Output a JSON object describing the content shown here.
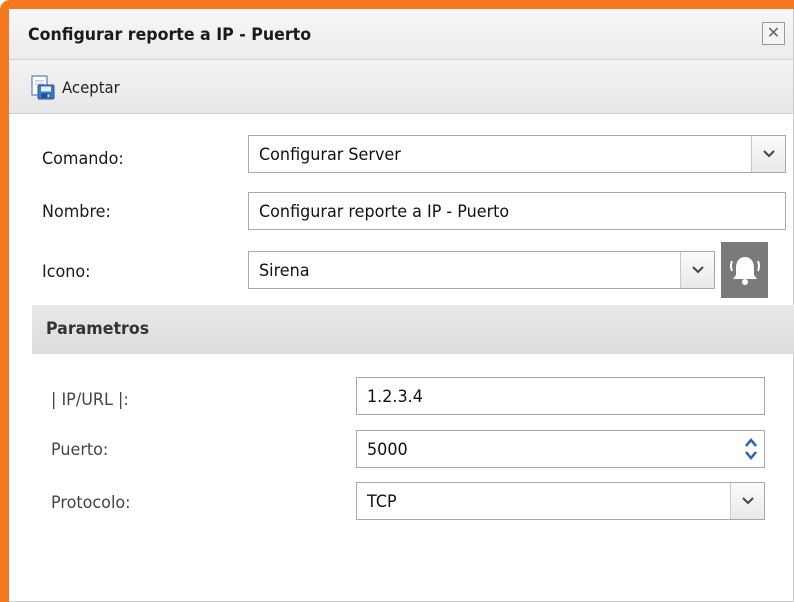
{
  "window": {
    "title": "Configurar reporte a IP - Puerto",
    "close_glyph": "✕"
  },
  "toolbar": {
    "accept_label": "Aceptar",
    "accept_icon": "save-document-icon"
  },
  "form": {
    "comando": {
      "label": "Comando:",
      "value": "Configurar Server"
    },
    "nombre": {
      "label": "Nombre:",
      "value": "Configurar reporte a IP - Puerto"
    },
    "icono": {
      "label": "Icono:",
      "value": "Sirena",
      "preview_icon": "bell-icon"
    }
  },
  "parametros": {
    "title": "Parametros",
    "ip": {
      "label": "| IP/URL |:",
      "value": "1.2.3.4"
    },
    "puerto": {
      "label": "Puerto:",
      "value": "5000"
    },
    "protocolo": {
      "label": "Protocolo:",
      "value": "TCP"
    }
  },
  "colors": {
    "accent_frame": "#f47a1f",
    "spinner_arrow": "#2a62b8",
    "bell_button_bg": "#7a7a7a"
  }
}
